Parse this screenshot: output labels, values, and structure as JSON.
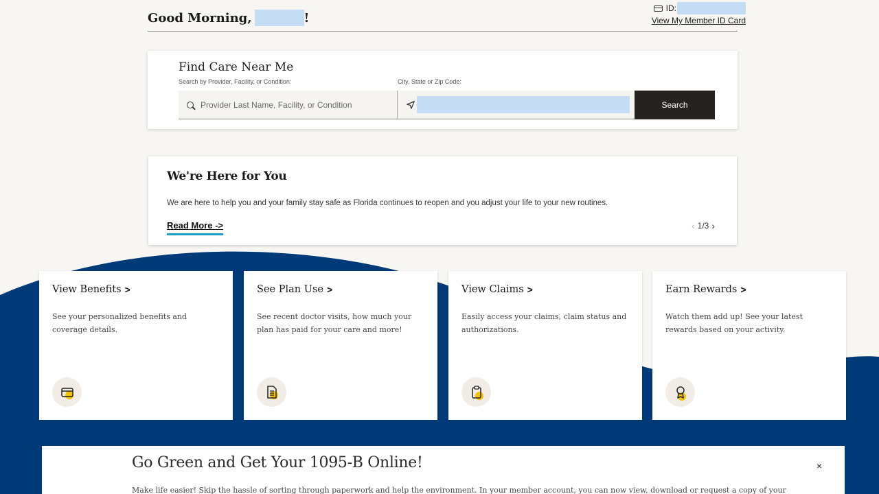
{
  "header": {
    "greeting_prefix": "Good Morning,",
    "greeting_suffix": "!",
    "id_label": "ID:",
    "member_card_link": "View My Member ID Card"
  },
  "find_care": {
    "title": "Find Care Near Me",
    "provider_label": "Search by Provider, Facility, or Condition:",
    "location_label": "City, State or Zip Code:",
    "provider_placeholder": "Provider Last Name, Facility, or Condition",
    "search_button": "Search"
  },
  "announcement": {
    "title": "We're Here for You",
    "body": "We are here to help you and your family stay safe as Florida continues to reopen and you adjust your life to your new routines.",
    "read_more": "Read More ->",
    "pager": "1/3"
  },
  "cards": [
    {
      "title": "View Benefits",
      "arrow": ">",
      "description": "See your personalized benefits and coverage details.",
      "icon": "credit-card-icon"
    },
    {
      "title": "See Plan Use",
      "arrow": ">",
      "description": "See recent doctor visits, how much your plan has paid for your care and more!",
      "icon": "document-icon"
    },
    {
      "title": "View Claims",
      "arrow": ">",
      "description": "Easily access your claims, claim status and authorizations.",
      "icon": "clipboard-icon"
    },
    {
      "title": "Earn Rewards",
      "arrow": ">",
      "description": "Watch them add up! See your latest rewards based on your activity.",
      "icon": "award-ribbon-icon"
    }
  ],
  "banner": {
    "title": "Go Green and Get Your 1095-B Online!",
    "text": "Make life easier! Skip the hassle of sorting through paperwork and help the environment. In your member account, you can now view, download or request a copy of your",
    "close": "×"
  },
  "colors": {
    "background": "#f8f6f3",
    "wave_navy": "#003a78",
    "button_dark": "#252220",
    "accent_teal": "#1a9bc8",
    "icon_yellow": "#f5c400",
    "redaction": "#c5dcf5"
  }
}
